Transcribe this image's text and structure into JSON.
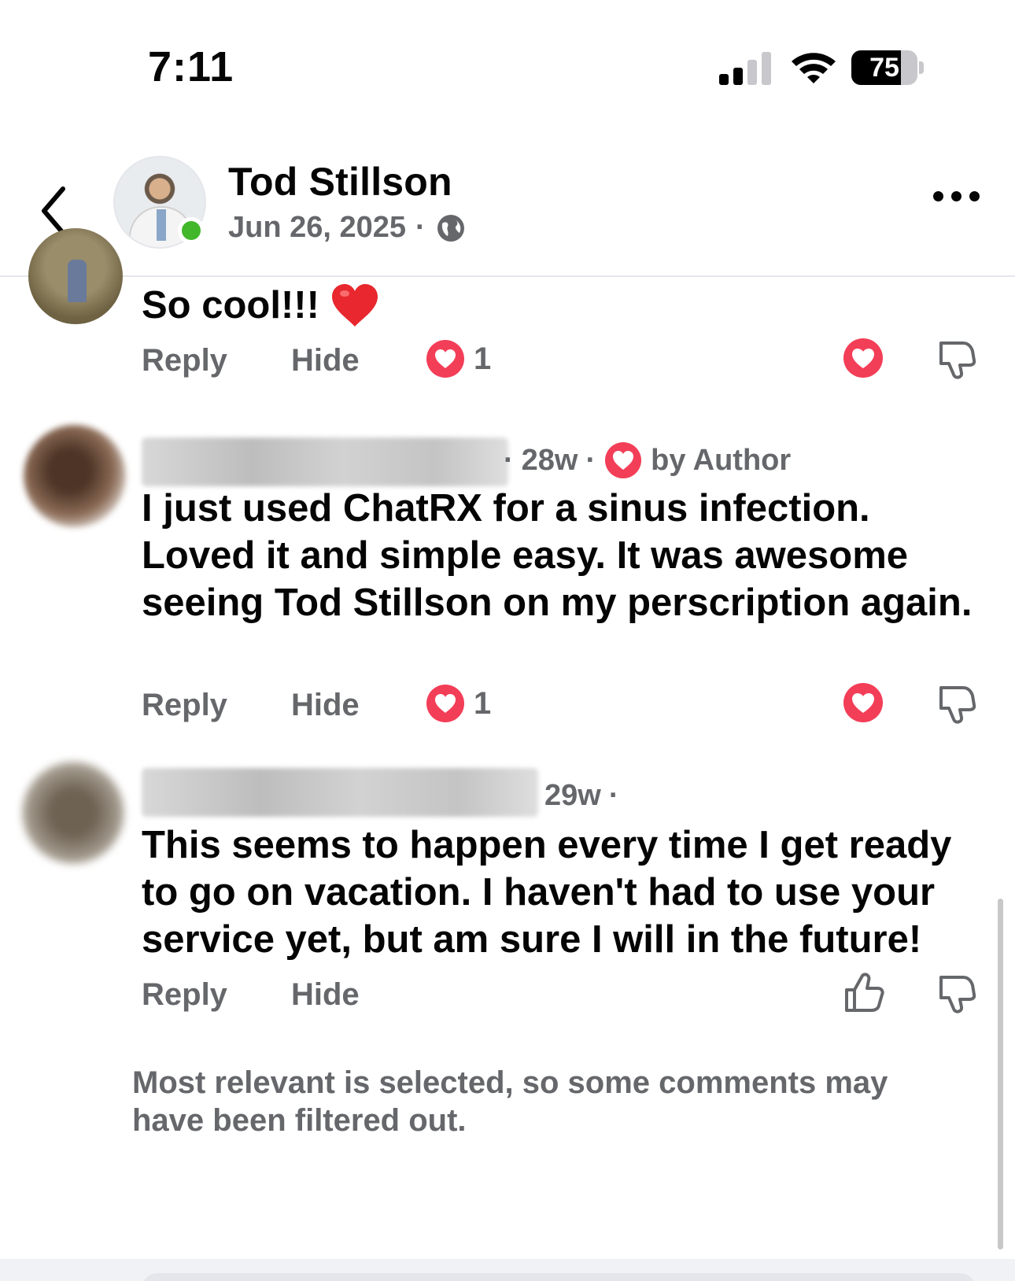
{
  "status_bar": {
    "time": "7:11",
    "battery_level": "75",
    "battery_fraction": 0.75
  },
  "header": {
    "name": "Tod Stillson",
    "date": "Jun 26, 2025",
    "date_separator": "·"
  },
  "comments": [
    {
      "text": "So cool!!!",
      "emoji": "red-heart",
      "reply_label": "Reply",
      "hide_label": "Hide",
      "reaction_count": "1"
    },
    {
      "time": "28w",
      "separator": "·",
      "author_badge": "by Author",
      "text": "I just used ChatRX for a sinus infection. Loved it and simple easy. It was awesome seeing Tod Stillson on my perscription again.",
      "reply_label": "Reply",
      "hide_label": "Hide",
      "reaction_count": "1"
    },
    {
      "time": "29w",
      "separator": "·",
      "text": "This seems to happen every time I get ready to go on vacation. I haven't had to use your service yet, but am sure I will in the future!",
      "reply_label": "Reply",
      "hide_label": "Hide"
    }
  ],
  "filter_notice": "Most relevant is selected, so some comments may have been filtered out.",
  "colors": {
    "love": "#f33e58",
    "secondary_text": "#65676b",
    "online": "#42b72a"
  },
  "icons": [
    "back-chevron-icon",
    "globe-icon",
    "more-icon",
    "heart-icon",
    "thumbs-down-icon",
    "thumbs-up-icon",
    "wifi-icon",
    "cellular-signal-icon",
    "battery-icon"
  ]
}
